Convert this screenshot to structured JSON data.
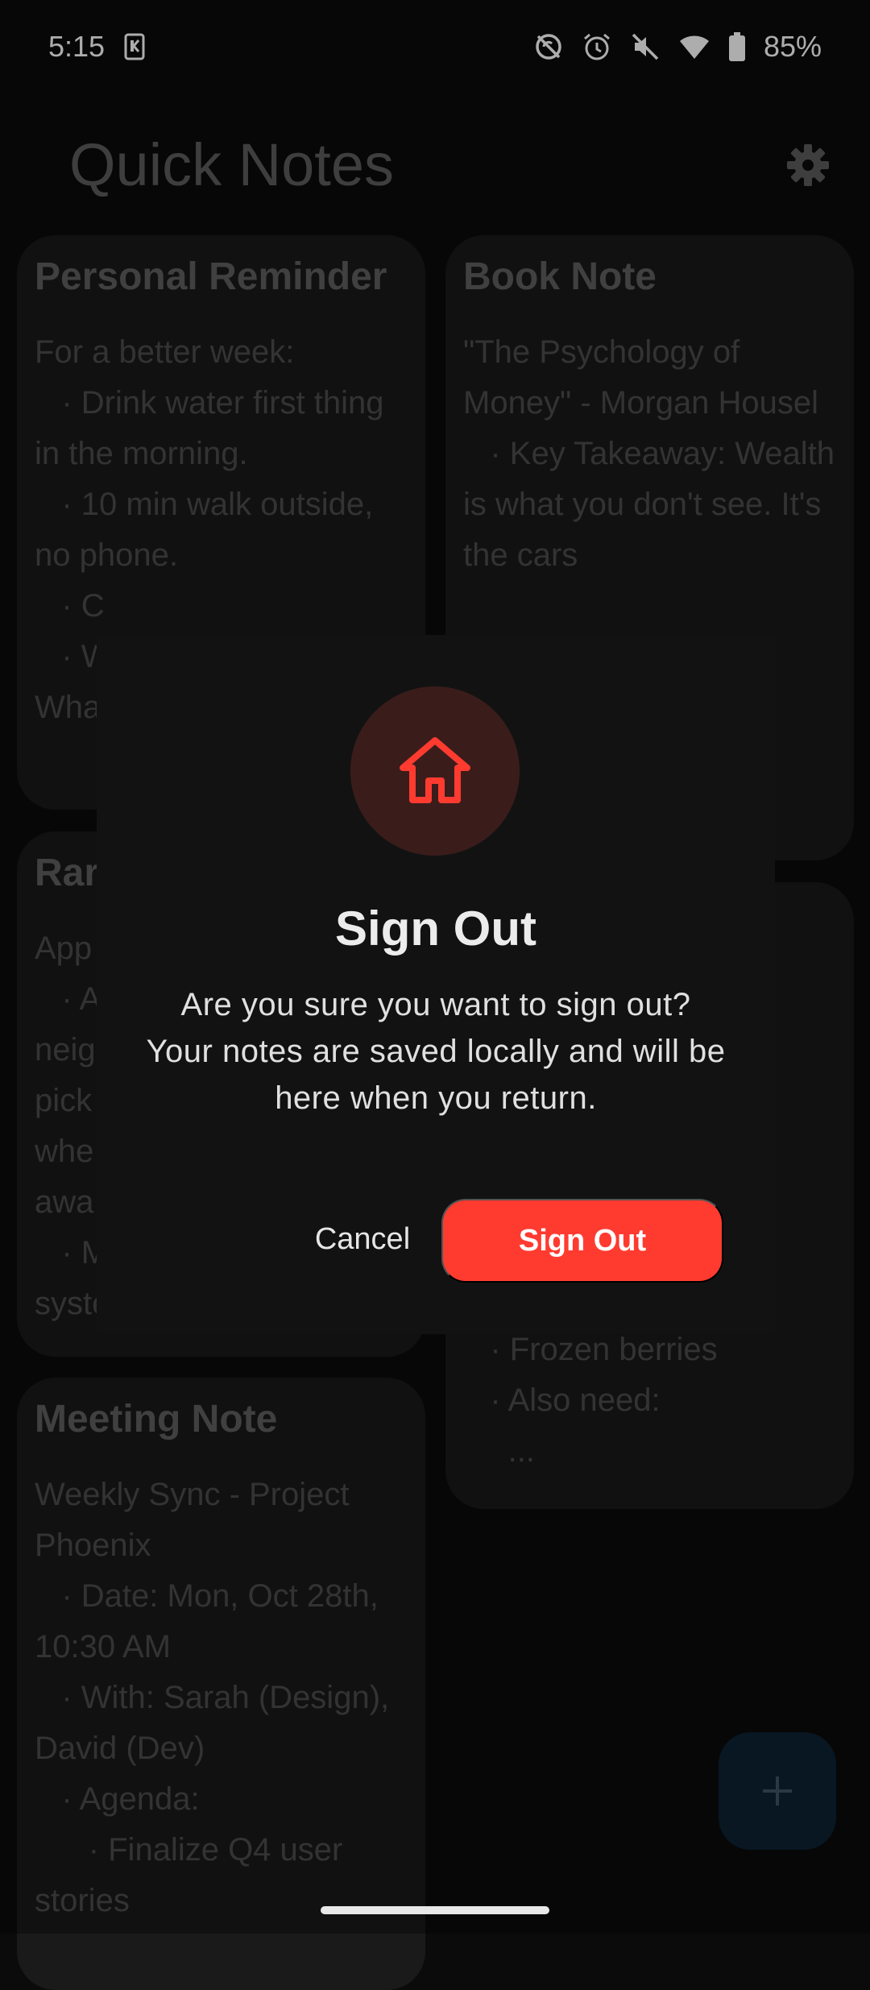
{
  "status_bar": {
    "time": "5:15",
    "battery": "85%",
    "icons": [
      "sim-card-icon",
      "no-sync-icon",
      "alarm-icon",
      "mute-icon",
      "wifi-icon",
      "battery-icon"
    ]
  },
  "app": {
    "title": "Quick Notes",
    "settings_icon": "gear-icon"
  },
  "notes": [
    {
      "id": "personal",
      "title": "Personal Reminder",
      "body": "For a better week:\n   · Drink water first thing in the morning.\n   · 10 min walk outside, no phone.\n   · C\n   · W\nWha"
    },
    {
      "id": "book",
      "title": "Book Note",
      "body": "\"The Psychology of Money\" - Morgan Housel\n   · Key Takeaway: Wealth is what you don't see. It's the cars"
    },
    {
      "id": "random",
      "title": "Rar",
      "body": "App\n   · A\nneig\npick\nwhe\nawa\n   · M\nsyste"
    },
    {
      "id": "grocery",
      "title": "",
      "body": "   · Frozen berries\n   · Also need:\n     ..."
    },
    {
      "id": "meeting",
      "title": "Meeting Note",
      "body": "Weekly Sync - Project Phoenix\n   · Date: Mon, Oct 28th, 10:30 AM\n   · With: Sarah (Design), David (Dev)\n   · Agenda:\n      · Finalize Q4 user stories"
    }
  ],
  "fab": {
    "label": "+",
    "icon": "plus-icon"
  },
  "dialog": {
    "icon": "home-icon",
    "title": "Sign Out",
    "message": "Are you sure you want to sign out? Your notes are saved locally and will be here when you return.",
    "cancel_label": "Cancel",
    "confirm_label": "Sign Out"
  },
  "colors": {
    "accent": "#ff3b30",
    "background": "#0b0b0b",
    "card": "#1a1a1a",
    "dialog": "#121212"
  }
}
